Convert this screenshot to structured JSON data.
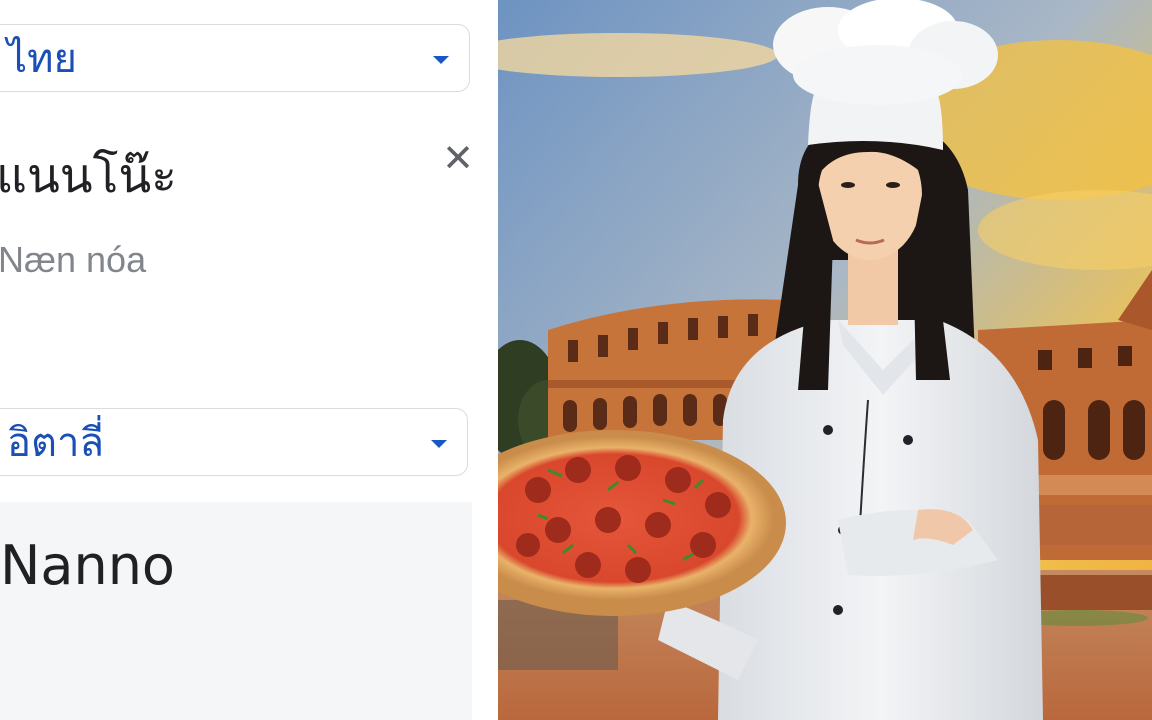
{
  "translator": {
    "source_language": "ไทย",
    "source_text": "แนนโน๊ะ",
    "transliteration": "Næn nóa",
    "clear_symbol": "✕",
    "target_language": "อิตาลี่",
    "translation": "Nanno"
  },
  "photo": {
    "icon": "chef-with-pizza-image",
    "colors": {
      "sky_top": "#6e95c4",
      "sky_warm": "#f2b83d",
      "colosseum": "#c9743a",
      "ground": "#c8784a",
      "chef_coat": "#eceef0",
      "hair": "#1c1614"
    }
  }
}
